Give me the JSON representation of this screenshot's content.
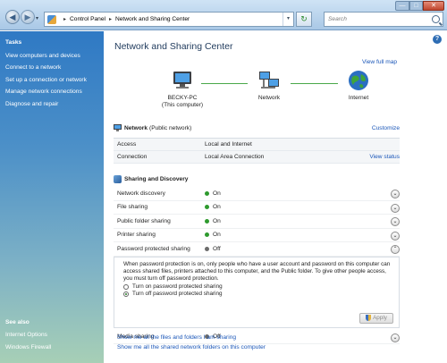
{
  "window": {
    "breadcrumb": [
      "Control Panel",
      "Network and Sharing Center"
    ],
    "search_placeholder": "Search",
    "controls": {
      "minimize": "—",
      "maximize": "□",
      "close": "✕"
    }
  },
  "sidebar": {
    "tasks_heading": "Tasks",
    "tasks": [
      "View computers and devices",
      "Connect to a network",
      "Set up a connection or network",
      "Manage network connections",
      "Diagnose and repair"
    ],
    "see_also_heading": "See also",
    "see_also": [
      "Internet Options",
      "Windows Firewall"
    ]
  },
  "main": {
    "title": "Network and Sharing Center",
    "view_full_map": "View full map",
    "map": {
      "computer_name": "BECKY-PC",
      "computer_sub": "(This computer)",
      "network_label": "Network",
      "internet_label": "Internet"
    },
    "network": {
      "name": "Network",
      "type": "(Public network)",
      "customize": "Customize",
      "rows": [
        {
          "label": "Access",
          "value": "Local and Internet",
          "link": ""
        },
        {
          "label": "Connection",
          "value": "Local Area Connection",
          "link": "View status"
        }
      ]
    },
    "sharing": {
      "heading": "Sharing and Discovery",
      "rows": [
        {
          "label": "Network discovery",
          "value": "On",
          "status_color": "#2e9a2e"
        },
        {
          "label": "File sharing",
          "value": "On",
          "status_color": "#2e9a2e"
        },
        {
          "label": "Public folder sharing",
          "value": "On",
          "status_color": "#2e9a2e"
        },
        {
          "label": "Printer sharing",
          "value": "On",
          "status_color": "#2e9a2e"
        },
        {
          "label": "Password protected sharing",
          "value": "Off",
          "status_color": "#6b6b6b"
        }
      ],
      "password_description": "When password protection is on, only people who have a user account and password on this computer can access shared files, printers attached to this computer, and the Public folder. To give other people access, you must turn off password protection.",
      "option_on": "Turn on password protected sharing",
      "option_off": "Turn off password protected sharing",
      "apply": "Apply",
      "media": {
        "label": "Media sharing",
        "value": "Off",
        "status_color": "#6b6b6b"
      }
    },
    "links": [
      "Show me all the files and folders I am sharing",
      "Show me all the shared network folders on this computer"
    ]
  }
}
